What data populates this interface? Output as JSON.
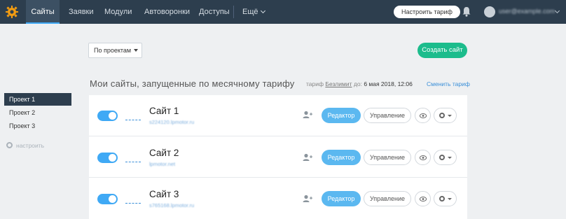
{
  "topbar": {
    "nav": [
      {
        "label": "Сайты",
        "active": true
      },
      {
        "label": "Заявки"
      },
      {
        "label": "Модули"
      },
      {
        "label": "Автоворонки"
      },
      {
        "label": "Доступы"
      },
      {
        "label": "Ещё"
      }
    ],
    "tariff_button": "Настроить тариф",
    "user_name": "user@example.com"
  },
  "controls": {
    "filter_selected": "По проектам",
    "create_button": "Создать сайт"
  },
  "section": {
    "title": "Мои сайты, запущенные по месячному тарифу",
    "tariff_prefix": "тариф",
    "tariff_name": "Безлимит",
    "tariff_until": "до:",
    "tariff_date": "6 мая 2018, 12:06",
    "change_tariff": "Сменить тариф"
  },
  "sidebar": {
    "projects": [
      {
        "label": "Проект 1",
        "active": true
      },
      {
        "label": "Проект 2"
      },
      {
        "label": "Проект 3"
      }
    ],
    "settings": "настроить"
  },
  "sites": [
    {
      "name": "Сайт 1",
      "domain": "s224120.lpmotor.ru",
      "editor": "Редактор",
      "manage": "Управление",
      "enabled": true
    },
    {
      "name": "Сайт 2",
      "domain": "lpmotor.net",
      "editor": "Редактор",
      "manage": "Управление",
      "enabled": true
    },
    {
      "name": "Сайт 3",
      "domain": "s765168.lpmotor.ru",
      "editor": "Редактор",
      "manage": "Управление",
      "enabled": true
    }
  ],
  "colors": {
    "topbar": "#2d3e4e",
    "accent_blue": "#3fa9f5",
    "create_green": "#1cbc8c"
  }
}
